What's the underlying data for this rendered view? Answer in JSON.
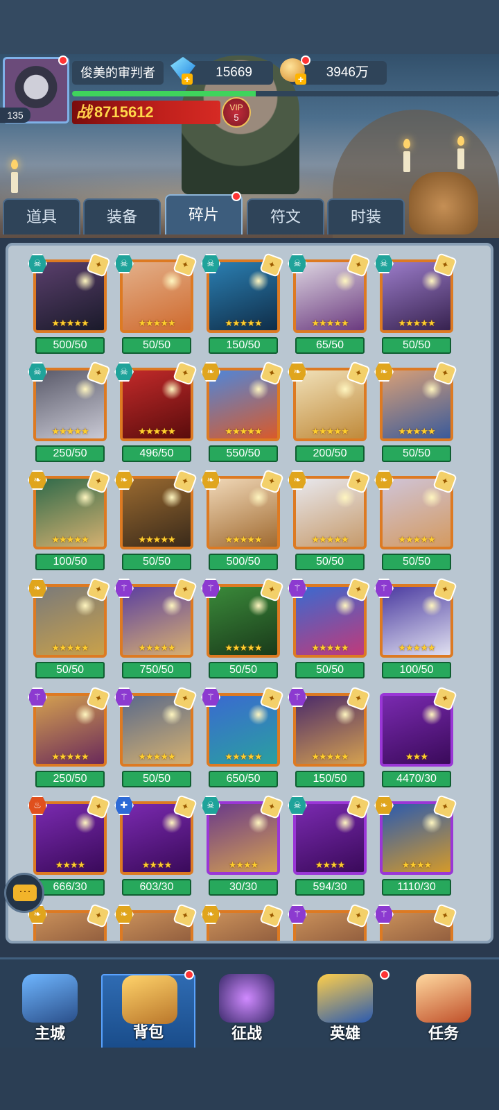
{
  "player": {
    "name": "俊美的审判者",
    "level": "135",
    "gems": "15669",
    "gold": "3946万",
    "power_prefix": "战",
    "power": "8715612",
    "vip_label": "VIP",
    "vip_level": "5",
    "exp_progress": 0.43
  },
  "tabs": [
    "道具",
    "装备",
    "碎片",
    "符文",
    "时装"
  ],
  "active_tab": "碎片",
  "items": [
    {
      "count": "500/50",
      "faction": "skull",
      "stars": "★★★★★",
      "frame": "orange",
      "art": [
        "#5a3f6c",
        "#1a1a2a"
      ]
    },
    {
      "count": "50/50",
      "faction": "skull",
      "stars": "★★★★★",
      "frame": "orange",
      "art": [
        "#e3b08a",
        "#cf6a2e"
      ]
    },
    {
      "count": "150/50",
      "faction": "skull",
      "stars": "★★★★★",
      "frame": "orange",
      "art": [
        "#2b7fb2",
        "#0f2d48"
      ]
    },
    {
      "count": "65/50",
      "faction": "skull",
      "stars": "★★★★★",
      "frame": "orange",
      "art": [
        "#dcd4e0",
        "#6b3a7f"
      ]
    },
    {
      "count": "50/50",
      "faction": "skull",
      "stars": "★★★★★",
      "frame": "orange",
      "art": [
        "#9b7cc9",
        "#37224f"
      ]
    },
    {
      "count": "250/50",
      "faction": "skull",
      "stars": "★★★★★",
      "frame": "orange",
      "art": [
        "#5a5a6a",
        "#c9c9d4"
      ]
    },
    {
      "count": "496/50",
      "faction": "skull",
      "stars": "★★★★★",
      "frame": "orange",
      "art": [
        "#c22a2a",
        "#5a0c0c"
      ]
    },
    {
      "count": "550/50",
      "faction": "wing",
      "stars": "★★★★★",
      "frame": "orange",
      "art": [
        "#4f86d9",
        "#d95a2a"
      ]
    },
    {
      "count": "200/50",
      "faction": "wing",
      "stars": "★★★★★",
      "frame": "orange",
      "art": [
        "#f0e0b8",
        "#c08a3a"
      ]
    },
    {
      "count": "50/50",
      "faction": "wing",
      "stars": "★★★★★",
      "frame": "orange",
      "art": [
        "#d9a077",
        "#3a5a9a"
      ]
    },
    {
      "count": "100/50",
      "faction": "wing",
      "stars": "★★★★★",
      "frame": "orange",
      "art": [
        "#2f6a4a",
        "#d4b070"
      ]
    },
    {
      "count": "50/50",
      "faction": "wing",
      "stars": "★★★★★",
      "frame": "orange",
      "art": [
        "#9a6a30",
        "#3a2a1a"
      ]
    },
    {
      "count": "500/50",
      "faction": "wing",
      "stars": "★★★★★",
      "frame": "orange",
      "art": [
        "#f0d8b8",
        "#a06a30"
      ]
    },
    {
      "count": "50/50",
      "faction": "wing",
      "stars": "★★★★★",
      "frame": "orange",
      "art": [
        "#e8e8ee",
        "#c69a6a"
      ]
    },
    {
      "count": "50/50",
      "faction": "wing",
      "stars": "★★★★★",
      "frame": "orange",
      "art": [
        "#cfc4d8",
        "#d49a60"
      ]
    },
    {
      "count": "50/50",
      "faction": "wing",
      "stars": "★★★★★",
      "frame": "orange",
      "art": [
        "#7a7a7a",
        "#c9a14a"
      ]
    },
    {
      "count": "750/50",
      "faction": "trident",
      "stars": "★★★★★",
      "frame": "orange",
      "art": [
        "#5a3fa0",
        "#d8b070"
      ]
    },
    {
      "count": "50/50",
      "faction": "trident",
      "stars": "★★★★★",
      "frame": "orange",
      "art": [
        "#3a8a3a",
        "#1a3a1a"
      ]
    },
    {
      "count": "50/50",
      "faction": "trident",
      "stars": "★★★★★",
      "frame": "orange",
      "art": [
        "#3a6ad0",
        "#c03a7a"
      ]
    },
    {
      "count": "100/50",
      "faction": "trident",
      "stars": "★★★★★",
      "frame": "orange",
      "art": [
        "#4a3aa0",
        "#e0e0f0"
      ]
    },
    {
      "count": "250/50",
      "faction": "trident",
      "stars": "★★★★★",
      "frame": "orange",
      "art": [
        "#d4a050",
        "#6a2a5a"
      ]
    },
    {
      "count": "50/50",
      "faction": "trident",
      "stars": "★★★★★",
      "frame": "orange",
      "art": [
        "#5a6a8a",
        "#d4b070"
      ]
    },
    {
      "count": "650/50",
      "faction": "trident",
      "stars": "★★★★★",
      "frame": "orange",
      "art": [
        "#3a6ad0",
        "#2aa0a0"
      ]
    },
    {
      "count": "150/50",
      "faction": "trident",
      "stars": "★★★★★",
      "frame": "orange",
      "art": [
        "#4a2a6a",
        "#d4a050"
      ]
    },
    {
      "count": "4470/30",
      "faction": "",
      "stars": "★★★",
      "frame": "purple",
      "art": [
        "#7a2ab0",
        "#3a0a5a"
      ]
    },
    {
      "count": "666/30",
      "faction": "fire",
      "stars": "★★★★",
      "frame": "orange",
      "art": [
        "#7a2ab0",
        "#3a0a5a"
      ]
    },
    {
      "count": "603/30",
      "faction": "cross",
      "stars": "★★★★",
      "frame": "orange",
      "art": [
        "#7a2ab0",
        "#3a0a5a"
      ]
    },
    {
      "count": "30/30",
      "faction": "skull",
      "stars": "★★★★",
      "frame": "purple",
      "art": [
        "#6a3a8a",
        "#d4a050"
      ]
    },
    {
      "count": "594/30",
      "faction": "skull",
      "stars": "★★★★",
      "frame": "purple",
      "art": [
        "#7a2ab0",
        "#3a0a5a"
      ]
    },
    {
      "count": "1110/30",
      "faction": "wing",
      "stars": "★★★★",
      "frame": "purple",
      "art": [
        "#2a5ab0",
        "#d49a2a"
      ]
    }
  ],
  "partial_row_factions": [
    "wing",
    "wing",
    "wing",
    "trident",
    "trident"
  ],
  "chat_label": "···",
  "nav": [
    "主城",
    "背包",
    "征战",
    "英雄",
    "任务"
  ],
  "active_nav": "背包",
  "colors": {
    "skull": "#1fa39a",
    "wing": "#e0a51d",
    "trident": "#8c3ad0",
    "fire": "#e0501d",
    "cross": "#2d6ad6",
    "count_bg": "#27a85c",
    "star": "#ffcf2e"
  }
}
